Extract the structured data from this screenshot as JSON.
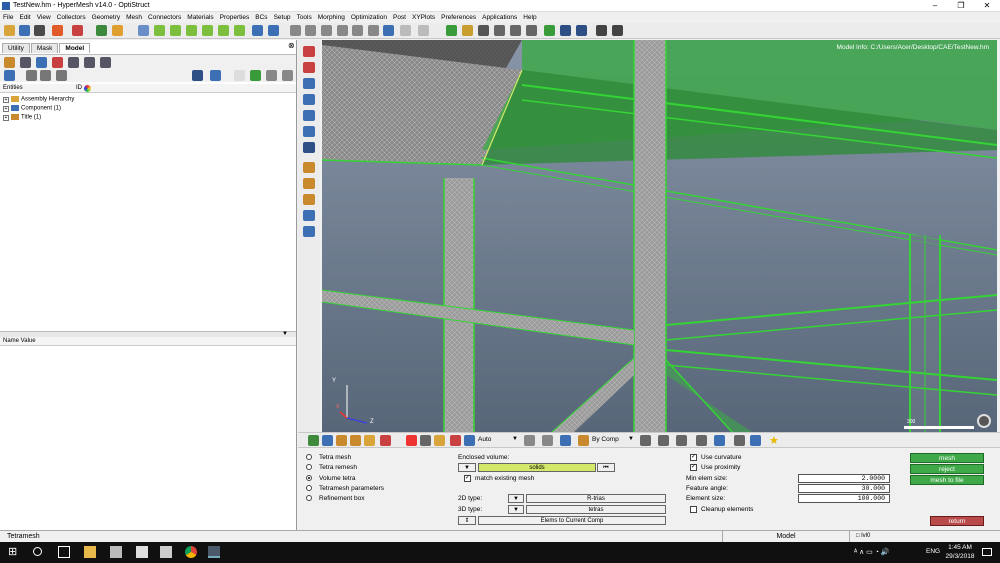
{
  "window": {
    "title": "TestNew.hm - HyperMesh v14.0 - OptiStruct",
    "minimize": "–",
    "maximize": "❐",
    "close": "✕"
  },
  "menu": [
    "File",
    "Edit",
    "View",
    "Collectors",
    "Geometry",
    "Mesh",
    "Connectors",
    "Materials",
    "Properties",
    "BCs",
    "Setup",
    "Tools",
    "Morphing",
    "Optimization",
    "Post",
    "XYPlots",
    "Preferences",
    "Applications",
    "Help"
  ],
  "tabs": [
    "Utility",
    "Mask",
    "Model"
  ],
  "browser": {
    "col_entities": "Entities",
    "col_id": "ID",
    "tree": [
      "Assembly Hierarchy",
      "Component (1)",
      "Title (1)"
    ],
    "col_name_value": "Name Value"
  },
  "viewport": {
    "model_info": "Model Info: C:/Users/Acer/Desktop/CAE/TestNew.hm",
    "axis_y": "Y",
    "axis_z": "Z",
    "axis_x": "X",
    "scale_label": "300"
  },
  "bottom_toolbar": {
    "auto_label": "Auto",
    "bycomp_label": "By Comp"
  },
  "panel": {
    "radios": [
      {
        "label": "Tetra mesh",
        "checked": false
      },
      {
        "label": "Tetra remesh",
        "checked": false
      },
      {
        "label": "Volume tetra",
        "checked": true
      },
      {
        "label": "Tetramesh parameters",
        "checked": false
      },
      {
        "label": "Refinement box",
        "checked": false
      }
    ],
    "enclosed_volume_label": "Enclosed volume:",
    "solids_button": "solids",
    "match_existing_mesh": "match existing mesh",
    "type2d_label": "2D type:",
    "type2d_value": "R-trias",
    "type3d_label": "3D type:",
    "type3d_value": "tetras",
    "elems_to_comp": "Elems to Current Comp",
    "use_curvature": "Use curvature",
    "use_proximity": "Use proximity",
    "min_elem_size_label": "Min elem size:",
    "min_elem_size": "2.0000",
    "feature_angle_label": "Feature angle:",
    "feature_angle": "30.000",
    "element_size_label": "Element size:",
    "element_size": "100.000",
    "cleanup_elements": "Cleanup elements",
    "btn_mesh": "mesh",
    "btn_reject": "reject",
    "btn_mesh_to_file": "mesh to file",
    "btn_return": "return"
  },
  "status": {
    "left": "Tetramesh",
    "model": "Model",
    "lvl": "lvl0"
  },
  "taskbar": {
    "lang": "ENG",
    "time": "1:45 AM",
    "date": "29/3/2018"
  },
  "colors": {
    "accent_green": "#3fa94a",
    "return_red": "#b84a4a",
    "mesh_green": "#35d435",
    "solids_yellow": "#d4e86a"
  }
}
